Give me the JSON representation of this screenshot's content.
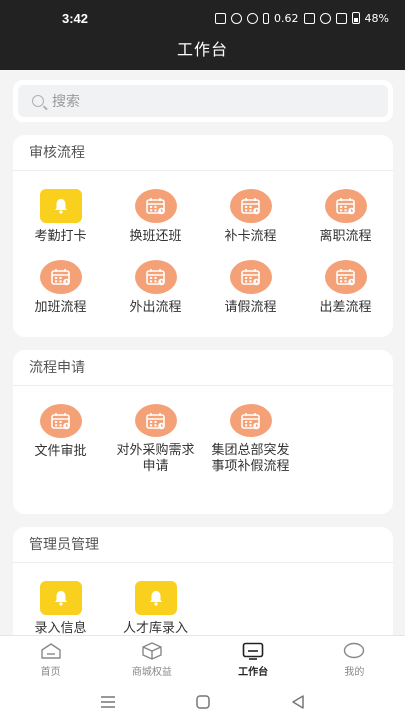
{
  "status_bar": {
    "time": "3:42",
    "speed": "0.62",
    "battery": "48%"
  },
  "header": {
    "title": "工作台"
  },
  "search": {
    "placeholder": "搜索"
  },
  "sections": [
    {
      "title": "审核流程",
      "items": [
        {
          "label": "考勤打卡",
          "icon": "bell-icon"
        },
        {
          "label": "换班还班",
          "icon": "calendar-icon"
        },
        {
          "label": "补卡流程",
          "icon": "calendar-icon"
        },
        {
          "label": "离职流程",
          "icon": "calendar-icon"
        },
        {
          "label": "加班流程",
          "icon": "calendar-icon"
        },
        {
          "label": "外出流程",
          "icon": "calendar-icon"
        },
        {
          "label": "请假流程",
          "icon": "calendar-icon"
        },
        {
          "label": "出差流程",
          "icon": "calendar-icon"
        }
      ]
    },
    {
      "title": "流程申请",
      "items": [
        {
          "label": "文件审批",
          "icon": "calendar-icon"
        },
        {
          "label": "对外采购需求申请",
          "icon": "calendar-icon"
        },
        {
          "label": "集团总部突发事项补假流程",
          "icon": "calendar-icon"
        }
      ]
    },
    {
      "title": "管理员管理",
      "items": [
        {
          "label": "录入信息",
          "icon": "bell-icon"
        },
        {
          "label": "人才库录入",
          "icon": "bell-icon"
        }
      ]
    }
  ],
  "tabbar": [
    {
      "label": "首页",
      "icon": "home-icon",
      "active": false
    },
    {
      "label": "商城权益",
      "icon": "box-icon",
      "active": false
    },
    {
      "label": "工作台",
      "icon": "monitor-icon",
      "active": true
    },
    {
      "label": "我的",
      "icon": "chat-icon",
      "active": false
    }
  ],
  "colors": {
    "bell": "#f9d01e",
    "calendar": "#f5a177",
    "header_bg": "#222222",
    "page_bg": "#f4f4f4"
  }
}
